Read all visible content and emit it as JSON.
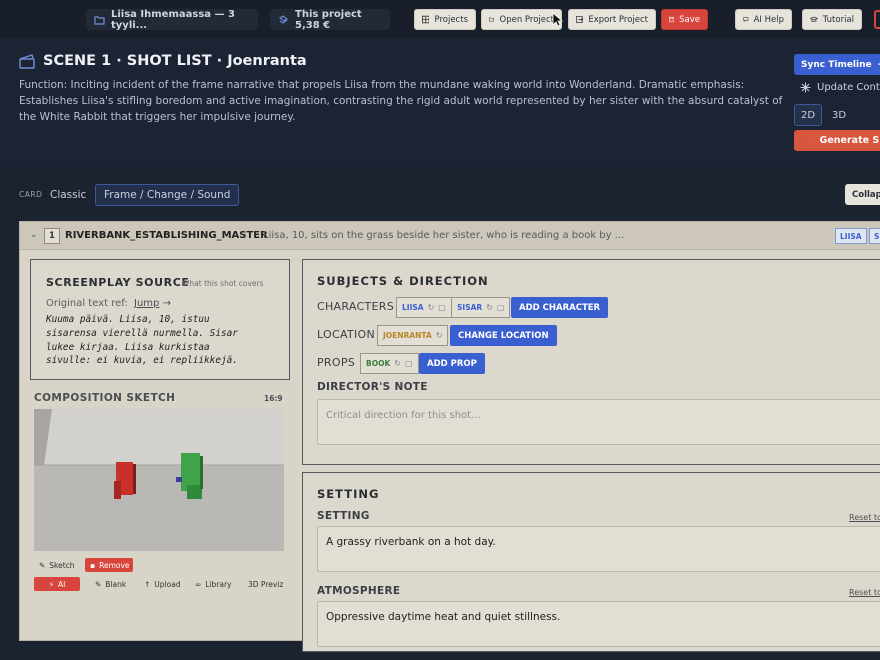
{
  "topbar": {
    "project_pill": "Liisa Ihmemaassa — 3 tyyli...",
    "cost_pill": "This project 5,38 €",
    "buttons": {
      "projects": "Projects",
      "open_project": "Open Project",
      "export_project": "Export Project",
      "save": "Save",
      "ai_help": "AI Help",
      "tutorial": "Tutorial"
    }
  },
  "header": {
    "title": "SCENE 1 · SHOT LIST · Joenranta",
    "function_text": "Function: Inciting incident of the frame narrative that propels Liisa from the mundane waking world into Wonderland. Dramatic emphasis: Establishes Liisa's stifling boredom and active imagination, contrasting the rigid adult world represented by her sister with the absurd catalyst of the White Rabbit that triggers her impulsive journey.",
    "sync_timeline": "Sync Timeline",
    "update_control": "Update Cont",
    "view_2d": "2D",
    "view_3d": "3D",
    "generate": "Generate Sh"
  },
  "card_bar": {
    "label": "CARD",
    "classic": "Classic",
    "frame_change_sound": "Frame / Change / Sound",
    "collapse": "Collaps"
  },
  "shot": {
    "number": "1",
    "name": "RIVERBANK_ESTABLISHING_MASTER",
    "description": "Liisa, 10, sits on the grass beside her sister, who is reading a book by ...",
    "tags": [
      "LIISA",
      "SI"
    ],
    "screenplay": {
      "title": "SCREENPLAY SOURCE",
      "subtitle": "What this shot covers",
      "orig_ref": "Original text ref:",
      "jump": "Jump",
      "text": "Kuuma päivä. Liisa, 10, istuu\nsisarensa vierellä nurmella. Sisar\nlukee kirjaa. Liisa kurkistaa\nsivulle: ei kuvia, ei repliikkejä."
    },
    "composition": {
      "title": "COMPOSITION SKETCH",
      "ratio": "16:9",
      "tools": {
        "sketch": "Sketch",
        "remove": "Remove",
        "ai": "AI",
        "blank": "Blank",
        "upload": "Upload",
        "library": "Library",
        "previz": "3D Previz"
      }
    },
    "subjects": {
      "title": "SUBJECTS & DIRECTION",
      "characters_label": "CHARACTERS",
      "characters": [
        "LIISA",
        "SISAR"
      ],
      "add_character": "ADD CHARACTER",
      "location_label": "LOCATION",
      "location": "JOENRANTA",
      "change_location": "CHANGE LOCATION",
      "props_label": "PROPS",
      "props": [
        "BOOK"
      ],
      "add_prop": "ADD PROP",
      "directors_note_label": "DIRECTOR'S NOTE",
      "directors_note_placeholder": "Critical direction for this shot..."
    },
    "setting": {
      "title": "SETTING",
      "setting_label": "SETTING",
      "setting_value": "A grassy riverbank on a hot day.",
      "atmosphere_label": "ATMOSPHERE",
      "atmosphere_value": "Oppressive daytime heat and quiet stillness.",
      "reset": "Reset to"
    }
  },
  "colors": {
    "accent": "#3a5fd0",
    "danger": "#d8453c",
    "card_bg": "#d8d4c8",
    "dark_bg": "#1b2230"
  }
}
